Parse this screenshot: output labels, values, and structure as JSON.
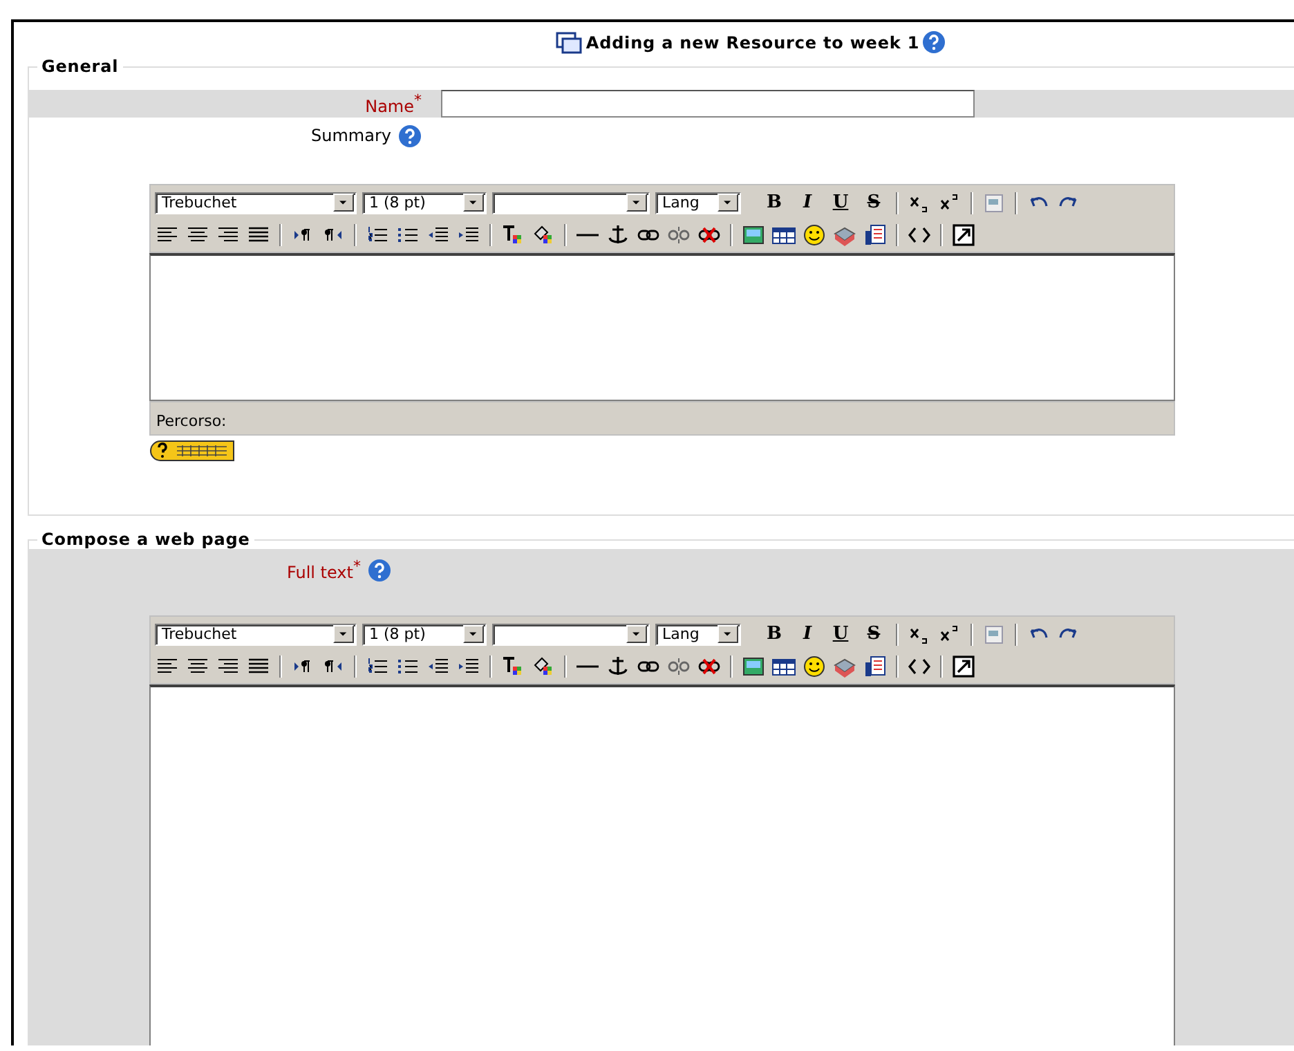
{
  "page_title": "Adding a new Resource to week 1",
  "general": {
    "legend": "General",
    "name_label": "Name",
    "name_required": "*",
    "summary_label": "Summary",
    "editor": {
      "font": "Trebuchet",
      "size": "1 (8 pt)",
      "language": "Lang",
      "style_buttons": [
        {
          "label": "B",
          "kind": "bold"
        },
        {
          "label": "I",
          "kind": "italic"
        },
        {
          "label": "U",
          "kind": "underline"
        },
        {
          "label": "S",
          "kind": "strike"
        }
      ],
      "path_label": "Percorso:"
    }
  },
  "compose": {
    "legend": "Compose a web page",
    "full_text_label": "Full text",
    "full_text_required": "*",
    "editor": {
      "font": "Trebuchet",
      "size": "1 (8 pt)",
      "language": "Lang",
      "style_buttons": [
        {
          "label": "B",
          "kind": "bold"
        },
        {
          "label": "I",
          "kind": "italic"
        },
        {
          "label": "U",
          "kind": "underline"
        },
        {
          "label": "S",
          "kind": "strike"
        }
      ]
    }
  }
}
